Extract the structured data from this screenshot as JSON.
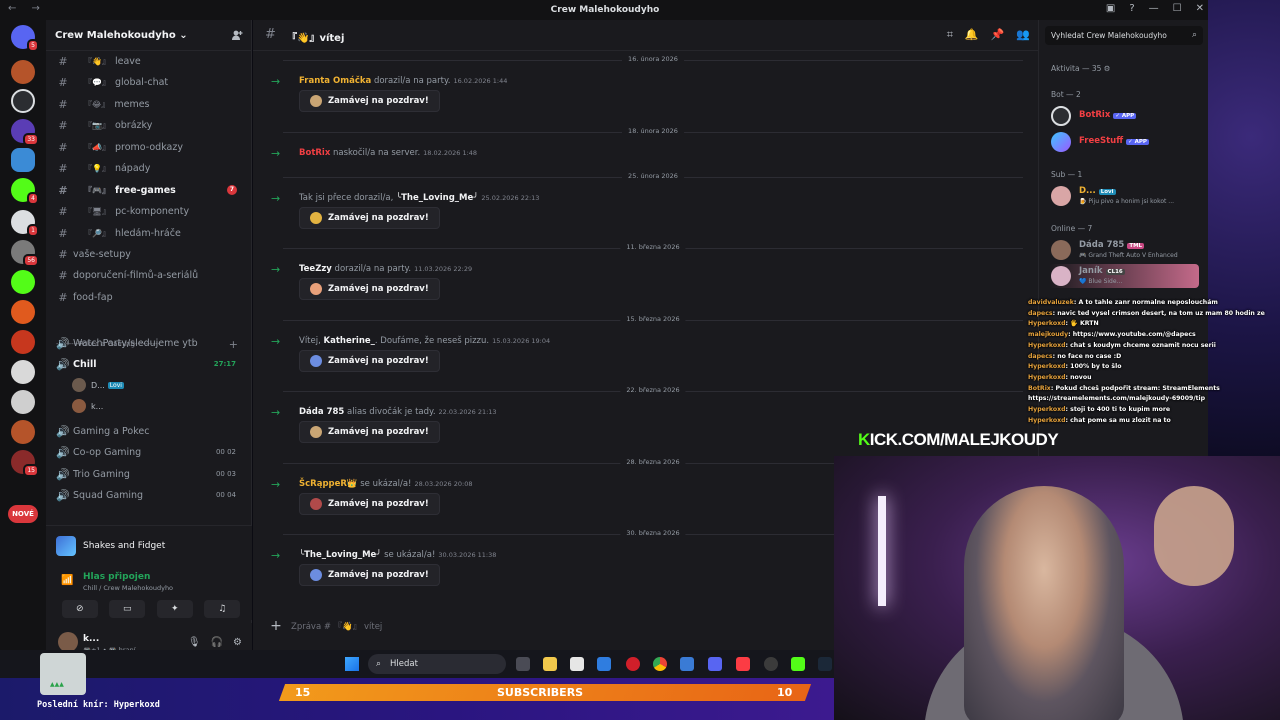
{
  "window": {
    "title": "Crew Malehokoudyho"
  },
  "server": {
    "name": "Crew Malehokoudyho ⌄"
  },
  "channels": [
    {
      "emoji": "『👋』",
      "label": "leave"
    },
    {
      "emoji": "『💬』",
      "label": "global-chat"
    },
    {
      "emoji": "『😂』",
      "label": "memes"
    },
    {
      "emoji": "『📷』",
      "label": "obrázky"
    },
    {
      "emoji": "『📣』",
      "label": "promo-odkazy"
    },
    {
      "emoji": "『💡』",
      "label": "nápady"
    },
    {
      "emoji": "『🎮』",
      "label": "free-games",
      "unread": "7"
    },
    {
      "emoji": "『🖥』",
      "label": "pc-komponenty"
    },
    {
      "emoji": "『🔎』",
      "label": "hledám-hráče"
    },
    {
      "emoji": "",
      "label": "vaše-setupy"
    },
    {
      "emoji": "",
      "label": "doporučení-filmů-a-seriálů"
    },
    {
      "emoji": "",
      "label": "food-fap"
    }
  ],
  "category": "---------Pokec a Gaming----------",
  "voice": [
    {
      "label": "WatchParty/sledujeme ytb"
    },
    {
      "label": "Chill",
      "count": "27:17"
    }
  ],
  "voice_users": [
    {
      "name": "D...",
      "tag": "Lovi"
    },
    {
      "name": "k..."
    }
  ],
  "voice2": [
    {
      "label": "Gaming a Pokec"
    },
    {
      "label": "Co-op Gaming",
      "count": "00 02"
    },
    {
      "label": "Trio Gaming",
      "count": "00 03"
    },
    {
      "label": "Squad Gaming",
      "count": "00 04"
    }
  ],
  "guild_badges": [
    "5",
    "33",
    "4",
    "1",
    "56",
    "15"
  ],
  "nove_label": "NOVÉ",
  "activity": {
    "label": "Shakes and Fidget"
  },
  "voice_panel": {
    "status": "Hlas připojen",
    "where": "Chill / Crew Malehokoudyho"
  },
  "user_panel": {
    "name": "k...",
    "status": "🎮+1 • 🎮 hraní"
  },
  "chat": {
    "channel_name": "『👋』vítej",
    "composer_placeholder": "Zpráva # 『👋』 vítej",
    "dates": [
      "16. února 2026",
      "18. února 2026",
      "25. února 2026",
      "11. března 2026",
      "15. března 2026",
      "22. března 2026",
      "28. března 2026",
      "30. března 2026"
    ],
    "messages": [
      {
        "pre": "",
        "user": "Franta Omáčka",
        "color": "#f0b232",
        "post": " dorazil/a na party.",
        "time": "16.02.2026 1:44",
        "wave": "Zamávej na pozdrav!"
      },
      {
        "pre": "",
        "user": "BotRix",
        "color": "#f23f43",
        "post": " naskočil/a na server.",
        "time": "18.02.2026 1:48",
        "wave": ""
      },
      {
        "pre": "Tak jsi přece dorazil/a, ",
        "user": "╰The_Loving_Me╯",
        "color": "#f2f3f5",
        "post": "",
        "time": "25.02.2026 22:13",
        "wave": "Zamávej na pozdrav!"
      },
      {
        "pre": "",
        "user": "TeeZzy",
        "color": "#f2f3f5",
        "post": " dorazil/a na party.",
        "time": "11.03.2026 22:29",
        "wave": "Zamávej na pozdrav!"
      },
      {
        "pre": "Vítej, ",
        "user": "Katherine_",
        "color": "#f2f3f5",
        "post": ". Doufáme, že neseš pizzu.",
        "time": "15.03.2026 19:04",
        "wave": "Zamávej na pozdrav!"
      },
      {
        "pre": "",
        "user": "Dáda 785",
        "color": "#f2f3f5",
        "post": " alias divočák je tady.",
        "time": "22.03.2026 21:13",
        "wave": "Zamávej na pozdrav!"
      },
      {
        "pre": "",
        "user": "ŠcRąppeR👑",
        "color": "#f0b232",
        "post": " se ukázal/a!",
        "time": "28.03.2026 20:08",
        "wave": "Zamávej na pozdrav!"
      },
      {
        "pre": "",
        "user": "╰The_Loving_Me╯",
        "color": "#f2f3f5",
        "post": " se ukázal/a!",
        "time": "30.03.2026 11:38",
        "wave": "Zamávej na pozdrav!"
      }
    ]
  },
  "members": {
    "search_placeholder": "Vyhledat Crew Malehokoudyho",
    "activity_header": "Aktivita — 35 ⚙",
    "groups": [
      {
        "header": "Bot — 2",
        "items": [
          {
            "name": "BotRix",
            "color": "#f23f43",
            "tag": "✓ APP",
            "tagcolor": "#5865f2",
            "status": ""
          },
          {
            "name": "FreeStuff",
            "color": "#f23f43",
            "tag": "✓ APP",
            "tagcolor": "#5865f2",
            "status": ""
          }
        ]
      },
      {
        "header": "Sub — 1",
        "items": [
          {
            "name": "D...",
            "color": "#f0b232",
            "tag": "Lovi",
            "tagcolor": "#1e8bb5",
            "status": "🍺 Piju pivo a honim jsi kokot ..."
          }
        ]
      },
      {
        "header": "Online — 7",
        "items": [
          {
            "name": "Dáda 785",
            "color": "#949ba4",
            "tag": "TML",
            "tagcolor": "#c94a84",
            "status": "🎮 Grand Theft Auto V Enhanced"
          },
          {
            "name": "Janík",
            "color": "#949ba4",
            "tag": "CL16",
            "tagcolor": "#444",
            "status": "💙 Blue Side..."
          }
        ]
      }
    ]
  },
  "taskbar": {
    "search": "Hledat"
  },
  "overlay": {
    "kick_k": "K",
    "kick_url": "ICK.COM/MALEJKOUDY",
    "sub_left": "15",
    "sub_label": "SUBSCRIBERS",
    "sub_right": "10",
    "last_sub": "Poslední knír: Hyperkoxd"
  },
  "stream_chat": [
    {
      "user": "davidvaluzek",
      "text": ": A to tahle zanr normalne neposlouchám"
    },
    {
      "user": "dapecs",
      "text": ": navic ted vysel crimson desert, na tom uz mam 80 hodin ze"
    },
    {
      "user": "Hyperkoxd",
      "text": ": 🖐 KRTN"
    },
    {
      "user": "malejkoudy",
      "text": ": https://www.youtube.com/@dapecs"
    },
    {
      "user": "Hyperkoxd",
      "text": ": chat s koudym chceme oznamit nocu serii"
    },
    {
      "user": "dapecs",
      "text": ": no face no case :D"
    },
    {
      "user": "Hyperkoxd",
      "text": ": 100% by to šlo"
    },
    {
      "user": "Hyperkoxd",
      "text": ": novou"
    },
    {
      "user": "BotRix",
      "text": ": Pokud chceš podpořit stream: StreamElements"
    },
    {
      "user": "",
      "text": "https://streamelements.com/malejkoudy-69009/tip"
    },
    {
      "user": "Hyperkoxd",
      "text": ": stoji to 400 ti to kupim more"
    },
    {
      "user": "Hyperkoxd",
      "text": ": chat pome sa mu zlozit na to"
    }
  ]
}
